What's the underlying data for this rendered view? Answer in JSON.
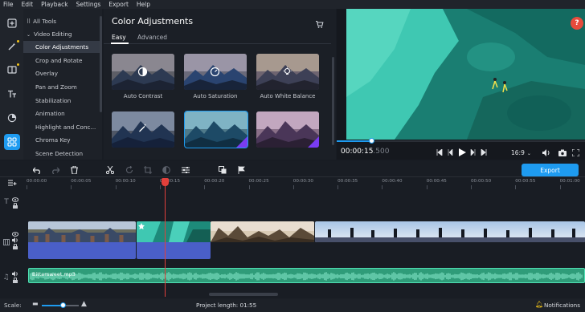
{
  "menu": [
    "File",
    "Edit",
    "Playback",
    "Settings",
    "Export",
    "Help"
  ],
  "sidebar": {
    "all_tools": "All Tools",
    "video_editing": "Video Editing",
    "items": [
      "Color Adjustments",
      "Crop and Rotate",
      "Overlay",
      "Pan and Zoom",
      "Stabilization",
      "Animation",
      "Highlight and Conc...",
      "Chroma Key",
      "Scene Detection"
    ]
  },
  "effects": {
    "title": "Color Adjustments",
    "tab_easy": "Easy",
    "tab_advanced": "Advanced",
    "presets": [
      "Auto Contrast",
      "Auto Saturation",
      "Auto White Balance"
    ]
  },
  "player": {
    "time_main": "00:00:15",
    "time_frac": ".500",
    "aspect": "16:9",
    "help": "?",
    "progress": 0.14
  },
  "toolbar": {
    "export_label": "Export"
  },
  "timeline": {
    "ticks": [
      "00:00:00",
      "00:00:05",
      "00:00:10",
      "00:00:15",
      "00:00:20",
      "00:00:25",
      "00:00:30",
      "00:00:35",
      "00:00:40",
      "00:00:45",
      "00:00:50",
      "00:00:55",
      "00:01:00"
    ],
    "audio_clip": "Bittersweet.mp3"
  },
  "status": {
    "scale_label": "Scale:",
    "project_length": "Project length: 01:55",
    "notifications": "Notifications"
  },
  "colors": {
    "accent": "#1e9bf0",
    "playhead": "#e2403b",
    "video_track": "#4a5fc8",
    "audio_wave": "#3bcfa0"
  }
}
